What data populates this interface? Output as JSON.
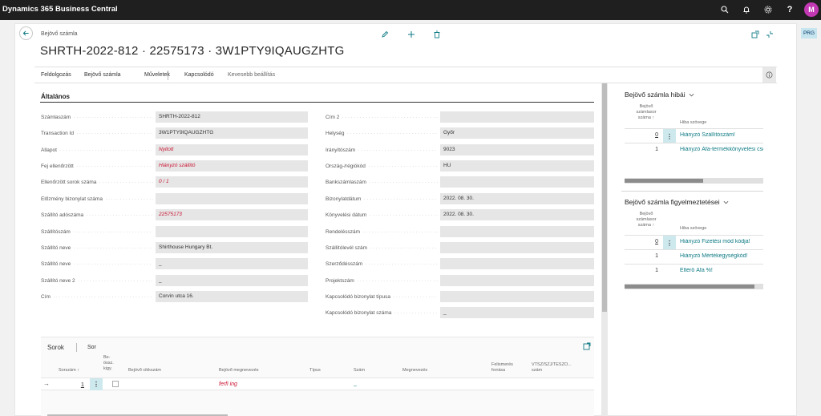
{
  "app": {
    "title": "Dynamics 365 Business Central",
    "user_initial": "M",
    "env_badge": "PRG"
  },
  "header": {
    "caption": "Bejövő számla",
    "title": "SHRTH-2022-812 · 22575173 · 3W1PTY9IQAUGZHTG"
  },
  "actions": [
    {
      "label": "Feldolgozás"
    },
    {
      "label": "Bejövő számla"
    },
    {
      "label": "Műveletek"
    },
    {
      "label": "Kapcsolódó"
    },
    {
      "label": "Kevesebb beállítás"
    }
  ],
  "general": {
    "title": "Általános",
    "left": [
      {
        "label": "Számlaszám",
        "value": "SHRTH-2022-812",
        "error": false
      },
      {
        "label": "Transaction Id",
        "value": "3W1PTY9IQAUGZHTG",
        "error": false
      },
      {
        "label": "Állapot",
        "value": "Nyitott",
        "error": true
      },
      {
        "label": "Fej ellenőrzött",
        "value": "Hiányzó szállító",
        "error": true
      },
      {
        "label": "Ellenőrzött sorok száma",
        "value": "0 / 1",
        "error": true
      },
      {
        "label": "Előzmény bizonylat száma",
        "value": "",
        "error": false
      },
      {
        "label": "Szállító adószáma",
        "value": "22575173",
        "error": true
      },
      {
        "label": "Szállítószám",
        "value": "",
        "error": false
      },
      {
        "label": "Szállító neve",
        "value": "Shirthouse Hungary Bt.",
        "error": false
      },
      {
        "label": "Szállító neve",
        "value": "_",
        "error": false
      },
      {
        "label": "Szállító neve 2",
        "value": "_",
        "error": false
      },
      {
        "label": "Cím",
        "value": "Corvin utca 16.",
        "error": false
      }
    ],
    "right": [
      {
        "label": "Cím 2",
        "value": ""
      },
      {
        "label": "Helység",
        "value": "Győr"
      },
      {
        "label": "Irányítószám",
        "value": "9023"
      },
      {
        "label": "Ország-/régiókód",
        "value": "HU"
      },
      {
        "label": "Bankszámlaszám",
        "value": ""
      },
      {
        "label": "Bizonylatdátum",
        "value": "2022. 08. 30."
      },
      {
        "label": "Könyvelési dátum",
        "value": "2022. 08. 30."
      },
      {
        "label": "Rendelésszám",
        "value": ""
      },
      {
        "label": "Szállítólevél szám",
        "value": ""
      },
      {
        "label": "Szerződésszám",
        "value": ""
      },
      {
        "label": "Projektszám",
        "value": ""
      },
      {
        "label": "Kapcsolódó bizonylat típusa",
        "value": ""
      },
      {
        "label": "Kapcsolódó bizonylat száma",
        "value": "_"
      }
    ]
  },
  "lines": {
    "tabs": [
      "Sorok",
      "Sor"
    ],
    "columns": {
      "line_no": "Sorszám ↑",
      "processed": "Be- össz. kigy.",
      "item_no": "Bejövő cikkszám",
      "description": "Bejövő megnevezés",
      "type": "Típus",
      "number": "Szám",
      "name": "Megnevezés",
      "source": "Felismerés forrása",
      "vat": "VTSZ/SZJ/TESZO... szám"
    },
    "rows": [
      {
        "line_no": "1",
        "description": "ferfi ing",
        "number": "_"
      }
    ]
  },
  "factbox_errors": {
    "title": "Bejövő számla hibái",
    "col_line": "Bejövő számlasor száma ↑",
    "col_text": "Hiba szövege",
    "rows": [
      {
        "line": "0",
        "text": "Hiányzó Szállítószám!"
      },
      {
        "line": "1",
        "text": "Hiányzó Áfa-termékkönyvelési csoport!"
      }
    ]
  },
  "factbox_warnings": {
    "title": "Bejövő számla figyelmeztetései",
    "col_line": "Bejövő számlasor száma ↑",
    "col_text": "Hiba szövege",
    "rows": [
      {
        "line": "0",
        "text": "Hiányzó Fizetési mód kódja!"
      },
      {
        "line": "1",
        "text": "Hiányzó Mértékegységkód!"
      },
      {
        "line": "1",
        "text": "Eltérő Áfa %!"
      }
    ]
  },
  "colors": {
    "accent": "#0e7a84",
    "error": "#c8102e",
    "topbar": "#1f1f1f",
    "avatar": "#c239b3"
  }
}
